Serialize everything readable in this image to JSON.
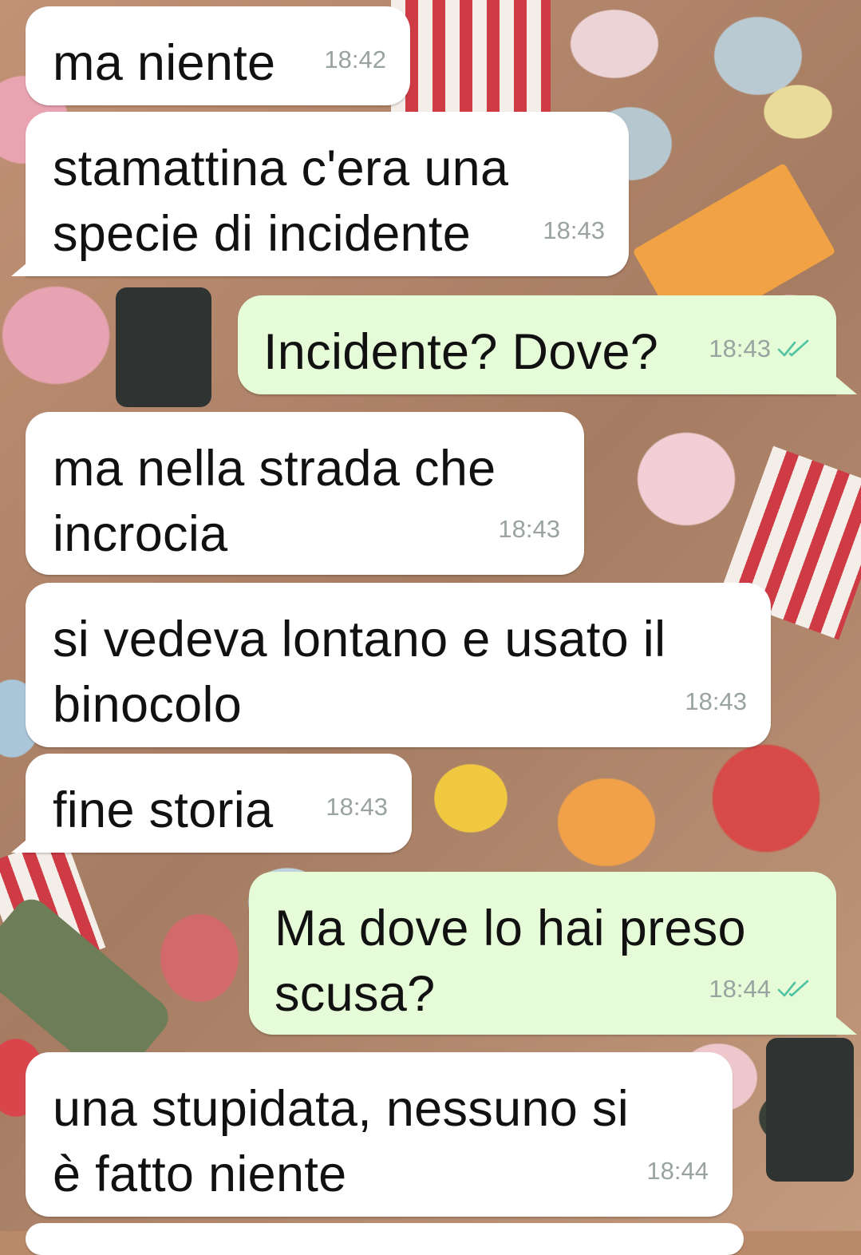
{
  "messages": [
    {
      "direction": "in",
      "text": "ma niente",
      "time": "18:42"
    },
    {
      "direction": "in",
      "text": "stamattina c'era una\nspecie di incidente",
      "time": "18:43"
    },
    {
      "direction": "out",
      "text": "Incidente? Dove?",
      "time": "18:43",
      "status": "read-double-check-icon"
    },
    {
      "direction": "in",
      "text": "ma nella strada che\nincrocia",
      "time": "18:43"
    },
    {
      "direction": "in",
      "text": "si vedeva lontano e usato il\nbinocolo",
      "time": "18:43"
    },
    {
      "direction": "in",
      "text": "fine storia",
      "time": "18:43"
    },
    {
      "direction": "out",
      "text": "Ma dove lo hai preso\nscusa?",
      "time": "18:44",
      "status": "read-double-check-icon"
    },
    {
      "direction": "in",
      "text": "una stupidata, nessuno si\nè fatto niente",
      "time": "18:44"
    }
  ],
  "colors": {
    "incoming_bubble": "#ffffff",
    "outgoing_bubble": "#e6fbd7",
    "timestamp": "#99a3a0",
    "read_tick": "#4fc3a1"
  }
}
